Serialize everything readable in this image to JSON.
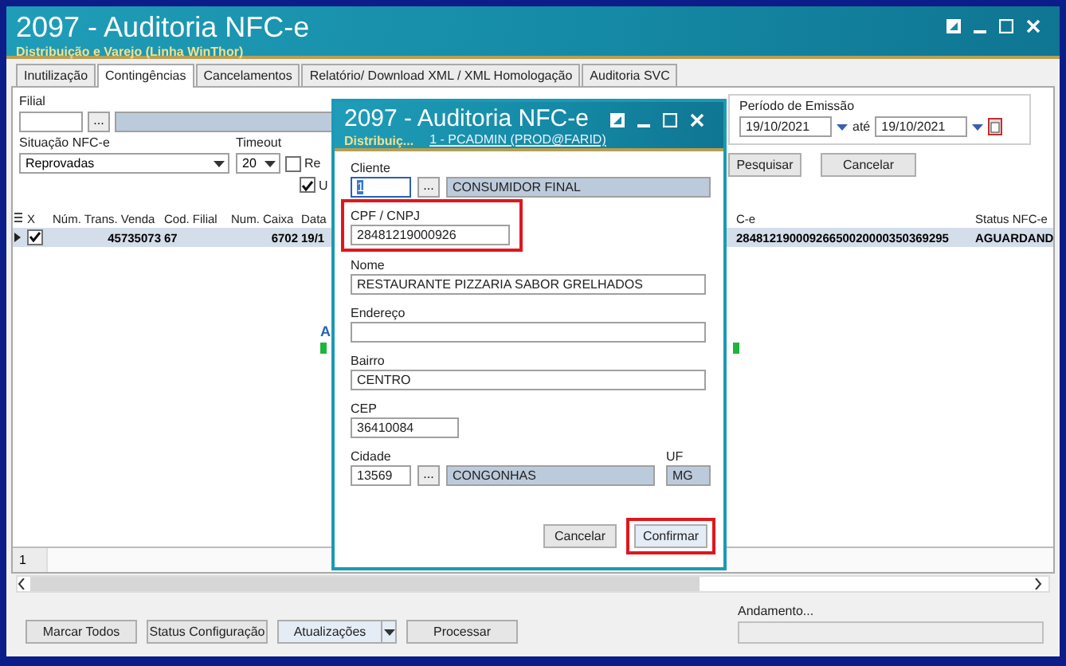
{
  "window": {
    "title": "2097 - Auditoria NFC-e",
    "subtitle": "Distribuição e Varejo (Linha WinThor)"
  },
  "tabs": [
    {
      "label": "Inutilização",
      "selected": false
    },
    {
      "label": "Contingências",
      "selected": true
    },
    {
      "label": "Cancelamentos",
      "selected": false
    },
    {
      "label": "Relatório/ Download XML / XML Homologação",
      "selected": false
    },
    {
      "label": "Auditoria SVC",
      "selected": false
    }
  ],
  "filters": {
    "filial_label": "Filial",
    "filial_button": "...",
    "situacao_label": "Situação NFC-e",
    "situacao_value": "Reprovadas",
    "timeout_label": "Timeout",
    "timeout_value": "20",
    "check_a": {
      "label": "Re",
      "checked": false
    },
    "check_b": {
      "label": "U",
      "checked": true
    },
    "periodo": {
      "label": "Período de Emissão",
      "from": "19/10/2021",
      "separator": "até",
      "to": "19/10/2021"
    },
    "buttons": [
      "Pesquisar",
      "Cancelar"
    ]
  },
  "grid": {
    "check_column": "X",
    "columns": [
      "Núm. Trans. Venda",
      "Cod. Filial",
      "Num. Caixa",
      "Data",
      "C-e",
      "Status NFC-e"
    ],
    "rows": [
      {
        "checked": true,
        "selected": true,
        "cells": [
          "45735073",
          "67",
          "6702",
          "19/1",
          "28481219000926650020000350369295",
          "AGUARDAND"
        ]
      }
    ],
    "overlay_text": "A",
    "page": "1"
  },
  "buttons": [
    {
      "label": "Marcar Todos",
      "kind": "plain"
    },
    {
      "label": "Status Configuração",
      "kind": "plain"
    },
    {
      "label": "Atualizações",
      "kind": "split"
    },
    {
      "label": "Processar",
      "kind": "plain"
    }
  ],
  "progress": {
    "label": "Andamento...",
    "level": 0
  },
  "dialog": {
    "title": "2097 - Auditoria NFC-e",
    "subtitle": "Distribuiç...",
    "user": "1 - PCADMIN (PROD@FARID)",
    "fields": [
      {
        "label": "Cliente",
        "kind": "lookup",
        "code": "1",
        "button": "...",
        "name": "CONSUMIDOR FINAL",
        "focused": true,
        "highlighted": false
      },
      {
        "label": "CPF / CNPJ",
        "kind": "short",
        "value": "28481219000926",
        "focused": false,
        "highlighted": true
      },
      {
        "label": "Nome",
        "kind": "text",
        "value": "RESTAURANTE PIZZARIA SABOR GRELHADOS",
        "focused": false,
        "highlighted": false
      },
      {
        "label": "Endereço",
        "kind": "text",
        "focused": false,
        "highlighted": false
      },
      {
        "label": "Bairro",
        "kind": "text",
        "value": "CENTRO",
        "focused": false,
        "highlighted": false
      },
      {
        "label": "CEP",
        "kind": "short",
        "value": "36410084",
        "focused": false,
        "highlighted": false
      },
      {
        "label": "Cidade",
        "kind": "lookup",
        "code": "13569",
        "button": "...",
        "name": "CONGONHAS",
        "focused": false,
        "highlighted": false,
        "uf": {
          "label": "UF",
          "value": "MG"
        }
      }
    ],
    "buttons": [
      {
        "label": "Cancelar",
        "highlighted": false
      },
      {
        "label": "Confirmar",
        "highlighted": true
      }
    ]
  }
}
